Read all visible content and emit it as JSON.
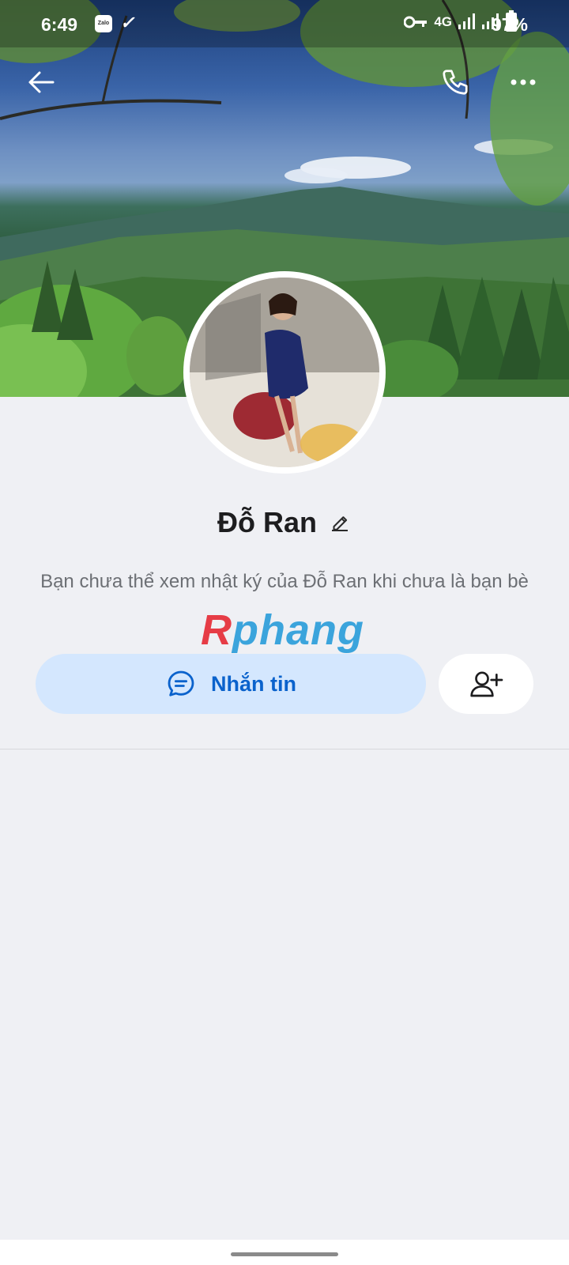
{
  "status_bar": {
    "time": "6:49",
    "zalo_badge": "Zalo",
    "network": "4G",
    "battery_percent": "97%"
  },
  "header": {
    "back_icon": "arrow-left-icon",
    "call_icon": "phone-icon",
    "more_icon": "more-dots-icon"
  },
  "profile": {
    "name": "Đỗ Ran",
    "notice": "Bạn chưa thể xem nhật ký của Đỗ Ran khi chưa là bạn bè"
  },
  "watermark": {
    "first": "R",
    "rest": "phang"
  },
  "actions": {
    "message_label": "Nhắn tin",
    "add_friend_icon": "add-friend-icon"
  },
  "colors": {
    "accent": "#0a62cc",
    "message_button_bg": "#d4e7fe",
    "page_bg": "#eff0f4"
  }
}
